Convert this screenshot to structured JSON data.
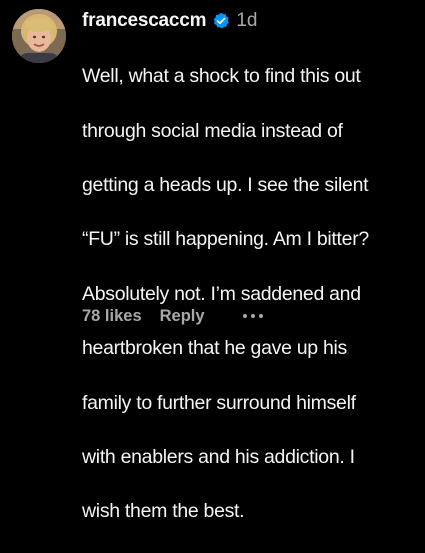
{
  "comment": {
    "username": "francescaccm",
    "verified": true,
    "timestamp": "1d",
    "lines": [
      "Well, what a shock to find this out",
      "through social media instead of",
      "getting a heads up. I see the silent",
      "“FU” is still happening. Am I bitter?",
      "Absolutely not. I’m saddened and",
      "heartbroken that he gave up his",
      "family to further surround himself",
      "with enablers and his addiction. I",
      "wish them the best."
    ],
    "likes": "78 likes",
    "reply_label": "Reply"
  },
  "icons": {
    "verified": "verified-badge-icon",
    "more": "more-options-icon"
  },
  "colors": {
    "background": "#000000",
    "text": "#f5f5f5",
    "secondary_text": "#a8a8a8",
    "verified_blue": "#0095f6"
  }
}
